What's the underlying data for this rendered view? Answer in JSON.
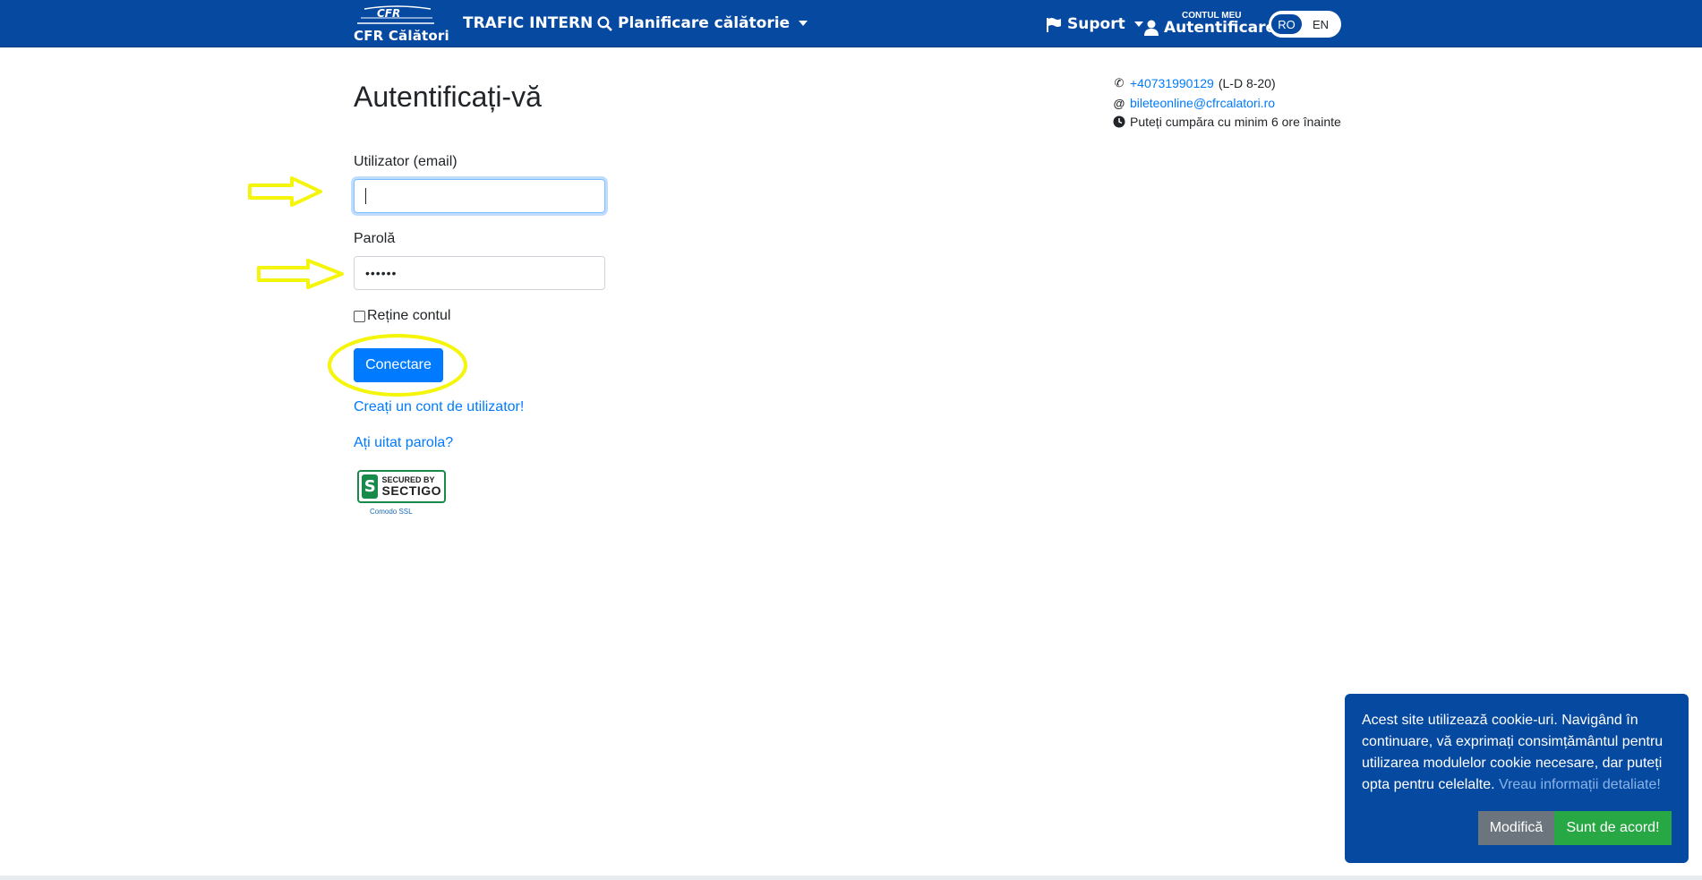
{
  "navbar": {
    "brand_logo_text": "CFR",
    "brand_name": "CFR Călători",
    "trafic_label": "TRAFIC INTERN",
    "planificare_label": "Planificare călătorie",
    "suport_label": "Suport",
    "account_small": "CONTUL MEU",
    "account_big": "Autentificare",
    "lang_ro": "RO",
    "lang_en": "EN"
  },
  "login": {
    "title": "Autentificați-vă",
    "user_label": "Utilizator (email)",
    "user_value": "",
    "pass_label": "Parolă",
    "pass_value": "••••••",
    "remember_label": "Reține contul",
    "submit_label": "Conectare",
    "create_account_link": "Creați un cont de utilizator!",
    "forgot_link": "Ați uitat parola?"
  },
  "seal": {
    "line1": "SECURED BY",
    "line2": "SECTIGO",
    "sub": "Comodo SSL"
  },
  "contact": {
    "phone": "+40731990129",
    "phone_hours": "(L-D 8-20)",
    "email": "bileteonline@cfrcalatori.ro",
    "notice": "Puteți cumpăra cu minim 6 ore înainte"
  },
  "cookie": {
    "text": "Acest site utilizează cookie-uri. Navigând în continuare, vă exprimați consimțământul pentru utilizarea modulelor cookie necesare, dar puteți opta pentru celelalte.",
    "details_link": "Vreau informații detaliate!",
    "modify_label": "Modifică",
    "agree_label": "Sunt de acord!"
  },
  "colors": {
    "navbar": "#0649a0",
    "primary": "#007bff",
    "success": "#28a745",
    "annotation": "#f5f50a"
  }
}
